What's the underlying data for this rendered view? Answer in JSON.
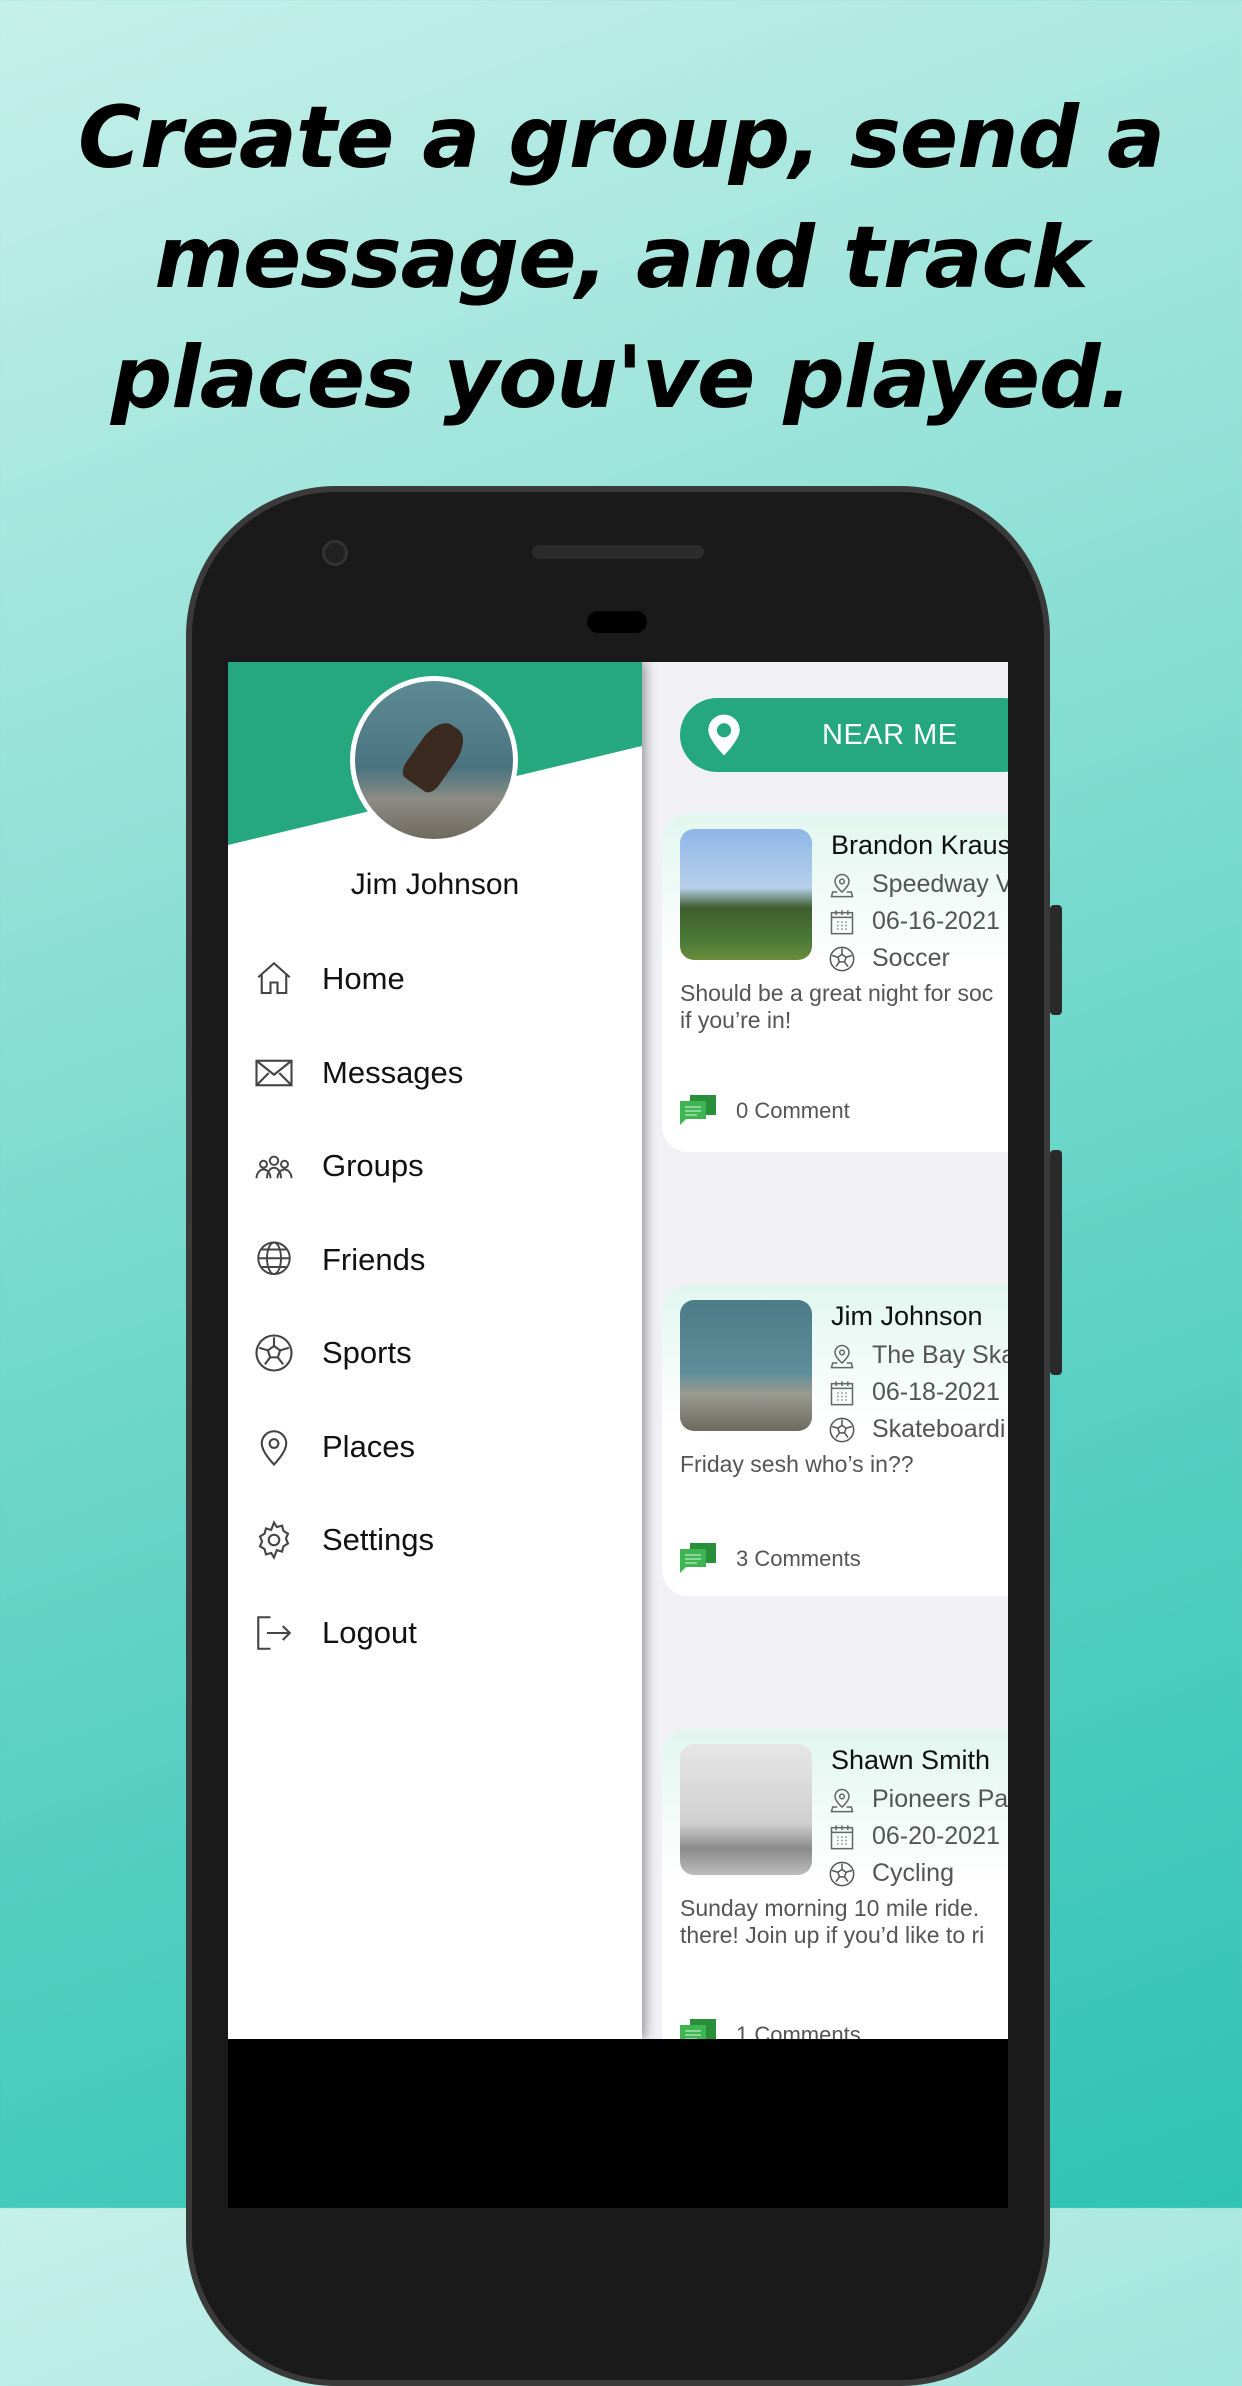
{
  "headline": [
    "Create a group, send a",
    "message, and track",
    "places you've played."
  ],
  "colors": {
    "accent": "#25a87d",
    "comment_icon": "#3cb552",
    "background_top": "#c6f0ea",
    "background_bottom": "#2fc3b3"
  },
  "drawer": {
    "user_name": "Jim Johnson",
    "items": [
      {
        "label": "Home",
        "icon": "home-icon"
      },
      {
        "label": "Messages",
        "icon": "envelope-icon"
      },
      {
        "label": "Groups",
        "icon": "groups-icon"
      },
      {
        "label": "Friends",
        "icon": "globe-people-icon"
      },
      {
        "label": "Sports",
        "icon": "soccer-ball-icon"
      },
      {
        "label": "Places",
        "icon": "map-pin-icon"
      },
      {
        "label": "Settings",
        "icon": "gear-icon"
      },
      {
        "label": "Logout",
        "icon": "logout-icon"
      }
    ]
  },
  "feed": {
    "near_me_label": "NEAR ME",
    "posts": [
      {
        "name": "Brandon Kraus",
        "place": "Speedway V",
        "date": "06-16-2021",
        "sport": "Soccer",
        "text": "Should be a great night for soc\nif you’re in!",
        "comments": "0 Comment"
      },
      {
        "name": "Jim Johnson",
        "place": "The Bay Ska",
        "date": "06-18-2021",
        "sport": "Skateboardi",
        "text": "Friday sesh who’s in??",
        "comments": "3 Comments"
      },
      {
        "name": "Shawn Smith",
        "place": "Pioneers Pa",
        "date": "06-20-2021",
        "sport": "Cycling",
        "text": "Sunday morning 10 mile ride. \nthere! Join up if you’d like to ri",
        "comments": "1 Comments"
      }
    ]
  }
}
